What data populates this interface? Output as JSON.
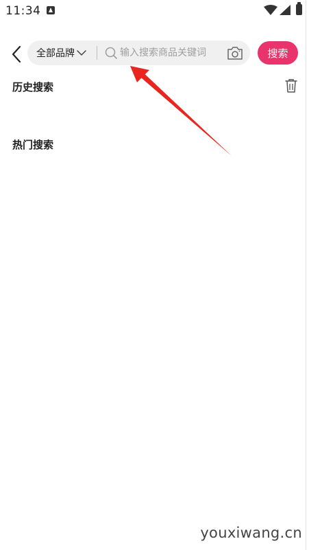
{
  "status_bar": {
    "time": "11:34",
    "notification_icon": "app-notification-icon",
    "wifi_icon": "wifi-icon",
    "signal_icon": "cell-signal-icon",
    "battery_icon": "battery-icon"
  },
  "header": {
    "back_icon": "chevron-left-icon",
    "brand_filter_label": "全部品牌",
    "search_placeholder": "输入搜索商品关键词",
    "search_value": "",
    "camera_icon": "camera-icon",
    "search_button_label": "搜索"
  },
  "sections": {
    "history_title": "历史搜索",
    "history_clear_icon": "trash-icon",
    "hot_title": "热门搜索"
  },
  "annotation": {
    "color": "#e8251f"
  },
  "colors": {
    "accent": "#e8336d",
    "search_box_bg": "#f0f0f0"
  },
  "watermark": "youxiwang.cn"
}
